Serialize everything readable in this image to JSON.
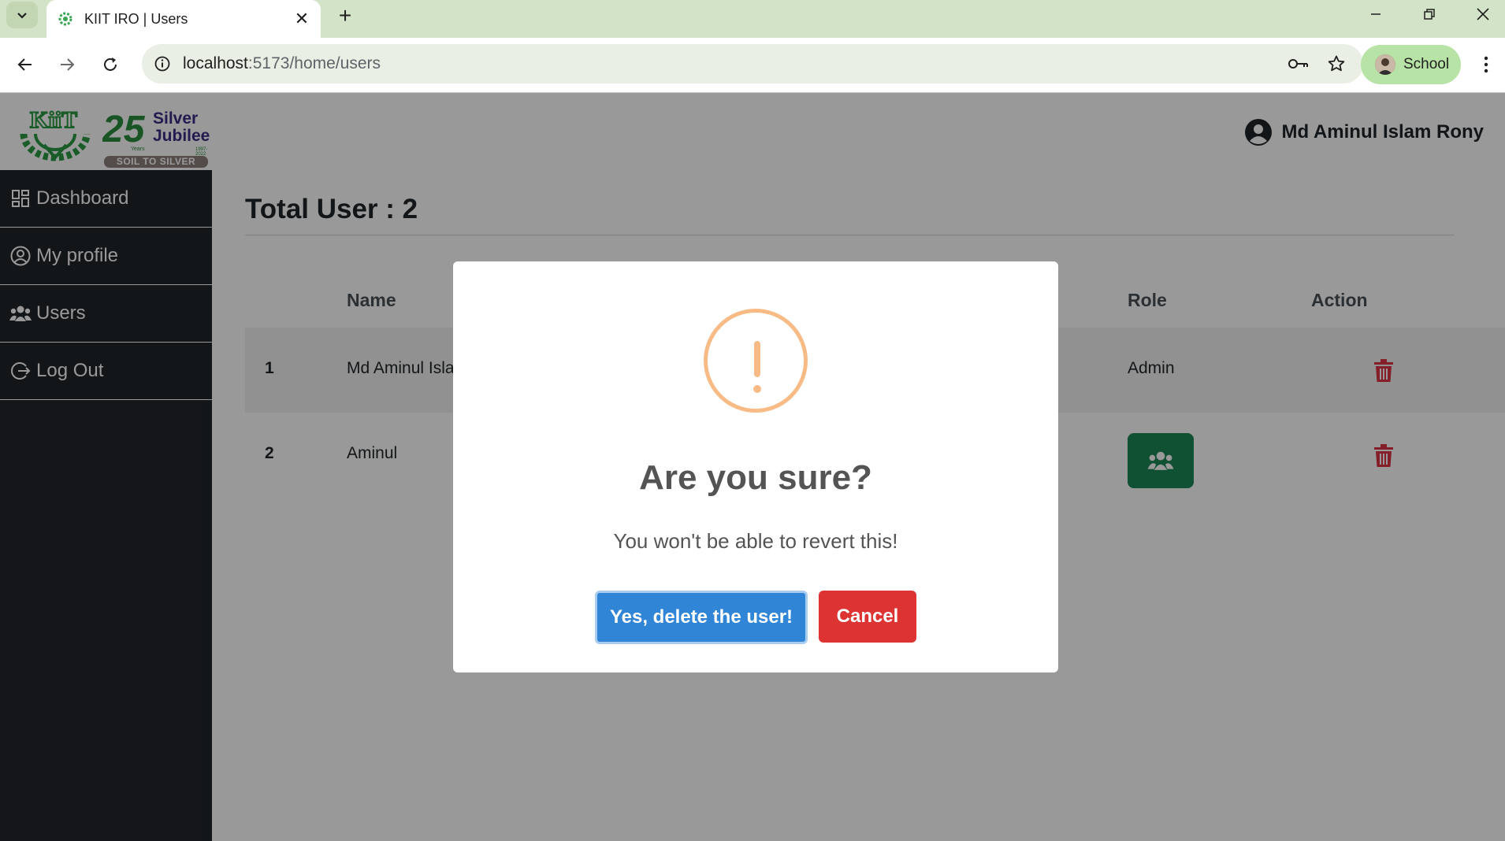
{
  "browser": {
    "tab_title": "KIIT IRO | Users",
    "url_host": "localhost",
    "url_path": ":5173/home/users",
    "profile_label": "School"
  },
  "header": {
    "logo_title_1": "Silver",
    "logo_title_2": "Jubilee",
    "logo_years": "Years",
    "logo_range": "1997-2022",
    "logo_tagline": "SOIL TO SILVER",
    "user_name": "Md Aminul Islam Rony"
  },
  "sidebar": {
    "items": [
      {
        "label": "Dashboard",
        "icon": "dashboard-icon"
      },
      {
        "label": "My profile",
        "icon": "user-circle-icon"
      },
      {
        "label": "Users",
        "icon": "users-icon"
      },
      {
        "label": "Log Out",
        "icon": "logout-icon"
      }
    ]
  },
  "main": {
    "title": "Total User : 2",
    "columns": {
      "name": "Name",
      "role": "Role",
      "action": "Action"
    },
    "rows": [
      {
        "num": "1",
        "name": "Md Aminul Isla",
        "role": "Admin"
      },
      {
        "num": "2",
        "name": "Aminul",
        "role": ""
      }
    ]
  },
  "dialog": {
    "title": "Are you sure?",
    "text": "You won't be able to revert this!",
    "confirm_label": "Yes, delete the user!",
    "cancel_label": "Cancel"
  },
  "colors": {
    "sidebar_bg": "#212529",
    "role_button": "#198754",
    "trash": "#dc3545",
    "confirm": "#3085d6",
    "cancel": "#dd3333",
    "warning": "#f8bb86"
  }
}
